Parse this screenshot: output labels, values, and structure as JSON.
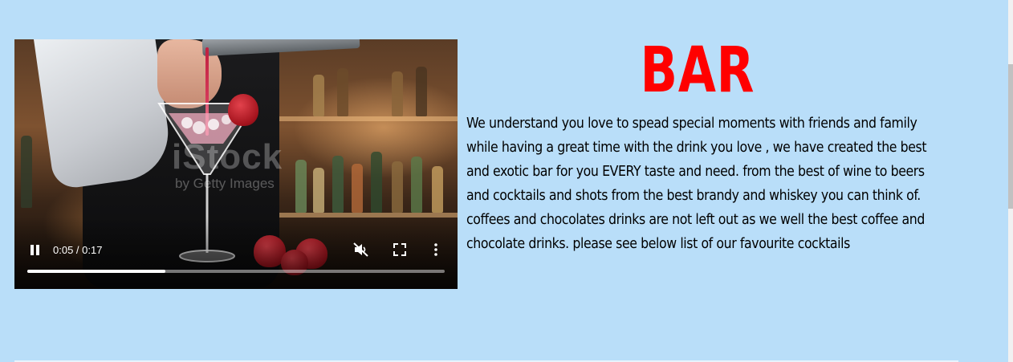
{
  "video": {
    "current_time": "0:05",
    "duration": "0:17",
    "time_display": "0:05 / 0:17",
    "progress_fraction": 0.33,
    "watermark": "iStock",
    "watermark_sub": "by Getty Images",
    "state": "playing",
    "muted": true
  },
  "content": {
    "title": "BAR",
    "title_color": "#ff0000",
    "description": "We understand you love to spead special moments with friends and family while having a great time with the drink you love , we have created the best and exotic bar for you EVERY taste and need. from the best of wine to beers and cocktails and shots from the best brandy and whiskey you can think of. coffees and chocolates drinks are not left out as we well the best coffee and chocolate drinks. please see below list of our favourite cocktails"
  },
  "theme": {
    "background": "#b9def9"
  },
  "icons": {
    "pause": "pause-icon",
    "mute": "volume-muted-icon",
    "fullscreen": "fullscreen-icon",
    "more": "more-vertical-icon"
  }
}
